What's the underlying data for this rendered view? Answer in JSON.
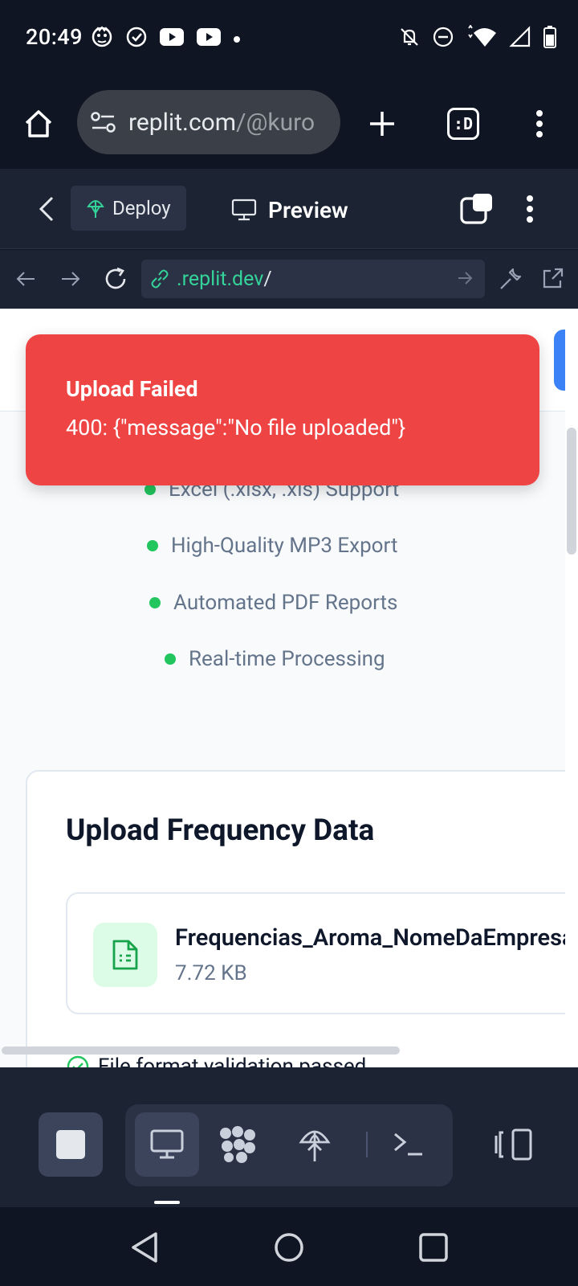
{
  "status_bar": {
    "time": "20:49",
    "left_icons": [
      "mascot-icon",
      "check-circle-icon",
      "youtube-icon",
      "youtube-icon",
      "dot-icon"
    ],
    "right_icons": [
      "bell-off-icon",
      "dnd-icon",
      "wifi-icon",
      "signal-icon",
      "battery-icon"
    ]
  },
  "browser": {
    "url_host": "replit.com",
    "url_path": "/@kuro",
    "tab_switcher_label": ":D"
  },
  "replit_header": {
    "deploy_label": "Deploy",
    "preview_label": "Preview"
  },
  "preview_bar": {
    "url_text": ".replit.dev",
    "url_slash": "/"
  },
  "toast": {
    "title": "Upload Failed",
    "message": "400: {\"message\":\"No file uploaded\"}"
  },
  "features": [
    "Excel (.xlsx, .xls) Support",
    "High-Quality MP3 Export",
    "Automated PDF Reports",
    "Real-time Processing"
  ],
  "upload_card": {
    "title": "Upload Frequency Data",
    "file_name": "Frequencias_Aroma_NomeDaEmpresa",
    "file_size": "7.72 KB",
    "validation_text": "File format validation passed"
  },
  "colors": {
    "toast_bg": "#ef4444",
    "accent_green": "#22c55e",
    "replit_bg": "#1c2333"
  }
}
